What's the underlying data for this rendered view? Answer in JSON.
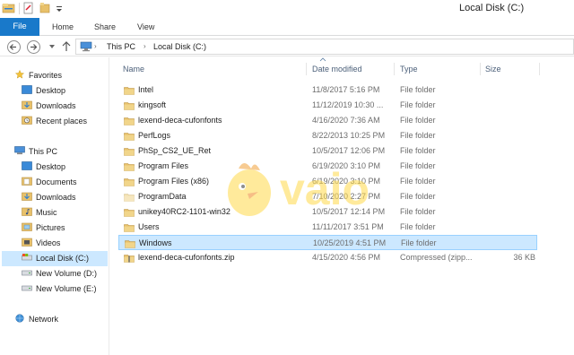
{
  "window": {
    "title": "Local Disk (C:)"
  },
  "ribbon": {
    "tabs": [
      "File",
      "Home",
      "Share",
      "View"
    ]
  },
  "address": {
    "crumbs": [
      "This PC",
      "Local Disk (C:)"
    ]
  },
  "nav": {
    "favorites_label": "Favorites",
    "favorites": [
      "Desktop",
      "Downloads",
      "Recent places"
    ],
    "thispc_label": "This PC",
    "thispc": [
      "Desktop",
      "Documents",
      "Downloads",
      "Music",
      "Pictures",
      "Videos",
      "Local Disk (C:)",
      "New Volume (D:)",
      "New Volume (E:)"
    ],
    "network_label": "Network"
  },
  "columns": {
    "name": "Name",
    "date": "Date modified",
    "type": "Type",
    "size": "Size"
  },
  "files": [
    {
      "name": "Intel",
      "date": "11/8/2017 5:16 PM",
      "type": "File folder",
      "size": "",
      "kind": "folder"
    },
    {
      "name": "kingsoft",
      "date": "11/12/2019 10:30 ...",
      "type": "File folder",
      "size": "",
      "kind": "folder"
    },
    {
      "name": "lexend-deca-cufonfonts",
      "date": "4/16/2020 7:36 AM",
      "type": "File folder",
      "size": "",
      "kind": "folder"
    },
    {
      "name": "PerfLogs",
      "date": "8/22/2013 10:25 PM",
      "type": "File folder",
      "size": "",
      "kind": "folder"
    },
    {
      "name": "PhSp_CS2_UE_Ret",
      "date": "10/5/2017 12:06 PM",
      "type": "File folder",
      "size": "",
      "kind": "folder"
    },
    {
      "name": "Program Files",
      "date": "6/19/2020 3:10 PM",
      "type": "File folder",
      "size": "",
      "kind": "folder"
    },
    {
      "name": "Program Files (x86)",
      "date": "6/19/2020 3:10 PM",
      "type": "File folder",
      "size": "",
      "kind": "folder"
    },
    {
      "name": "ProgramData",
      "date": "7/10/2020 2:27 PM",
      "type": "File folder",
      "size": "",
      "kind": "folder-faded"
    },
    {
      "name": "unikey40RC2-1101-win32",
      "date": "10/5/2017 12:14 PM",
      "type": "File folder",
      "size": "",
      "kind": "folder"
    },
    {
      "name": "Users",
      "date": "11/11/2017 3:51 PM",
      "type": "File folder",
      "size": "",
      "kind": "folder"
    },
    {
      "name": "Windows",
      "date": "10/25/2019 4:51 PM",
      "type": "File folder",
      "size": "",
      "kind": "folder"
    },
    {
      "name": "lexend-deca-cufonfonts.zip",
      "date": "4/15/2020 4:56 PM",
      "type": "Compressed (zipp...",
      "size": "36 KB",
      "kind": "zip"
    }
  ],
  "selected_file": "Windows",
  "selected_nav": "Local Disk (C:)",
  "watermark": {
    "text": "vaio"
  },
  "colors": {
    "accent": "#1979ca",
    "selection": "#cce8ff",
    "folder": "#e8c16a"
  }
}
